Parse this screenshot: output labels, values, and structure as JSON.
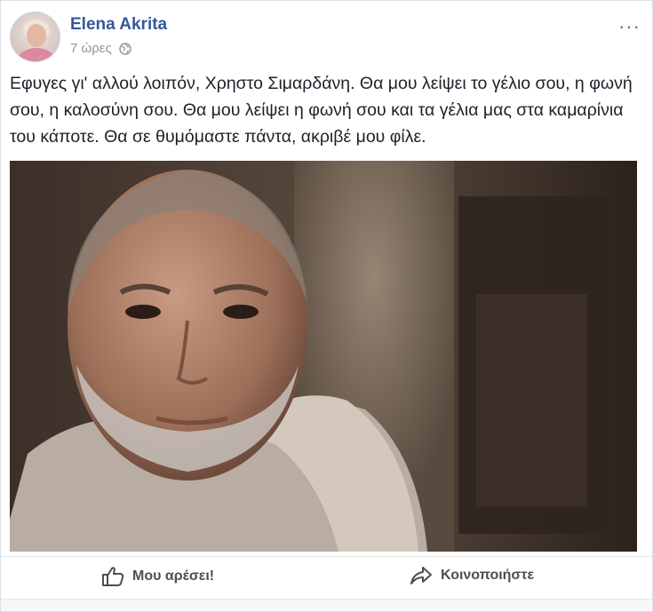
{
  "post": {
    "author": "Elena Akrita",
    "timestamp": "7 ώρες",
    "privacy_icon": "globe-icon",
    "menu_label": "···",
    "text": "Εφυγες γι' αλλού λοιπόν, Χρηστο Σιμαρδάνη. Θα μου λείψει το γέλιο σου, η φωνή σου, η καλοσύνη σου. Θα μου λείψει η φωνή σου και τα γέλια μας στα καμαρίνια του κάποτε. Θα σε θυμόμαστε πάντα, ακριβέ μου φίλε."
  },
  "actions": {
    "like_label": "Μου αρέσει!",
    "share_label": "Κοινοποιήστε"
  },
  "colors": {
    "author_link": "#365899",
    "meta_gray": "#90949c",
    "action_gray": "#4b4f56"
  }
}
